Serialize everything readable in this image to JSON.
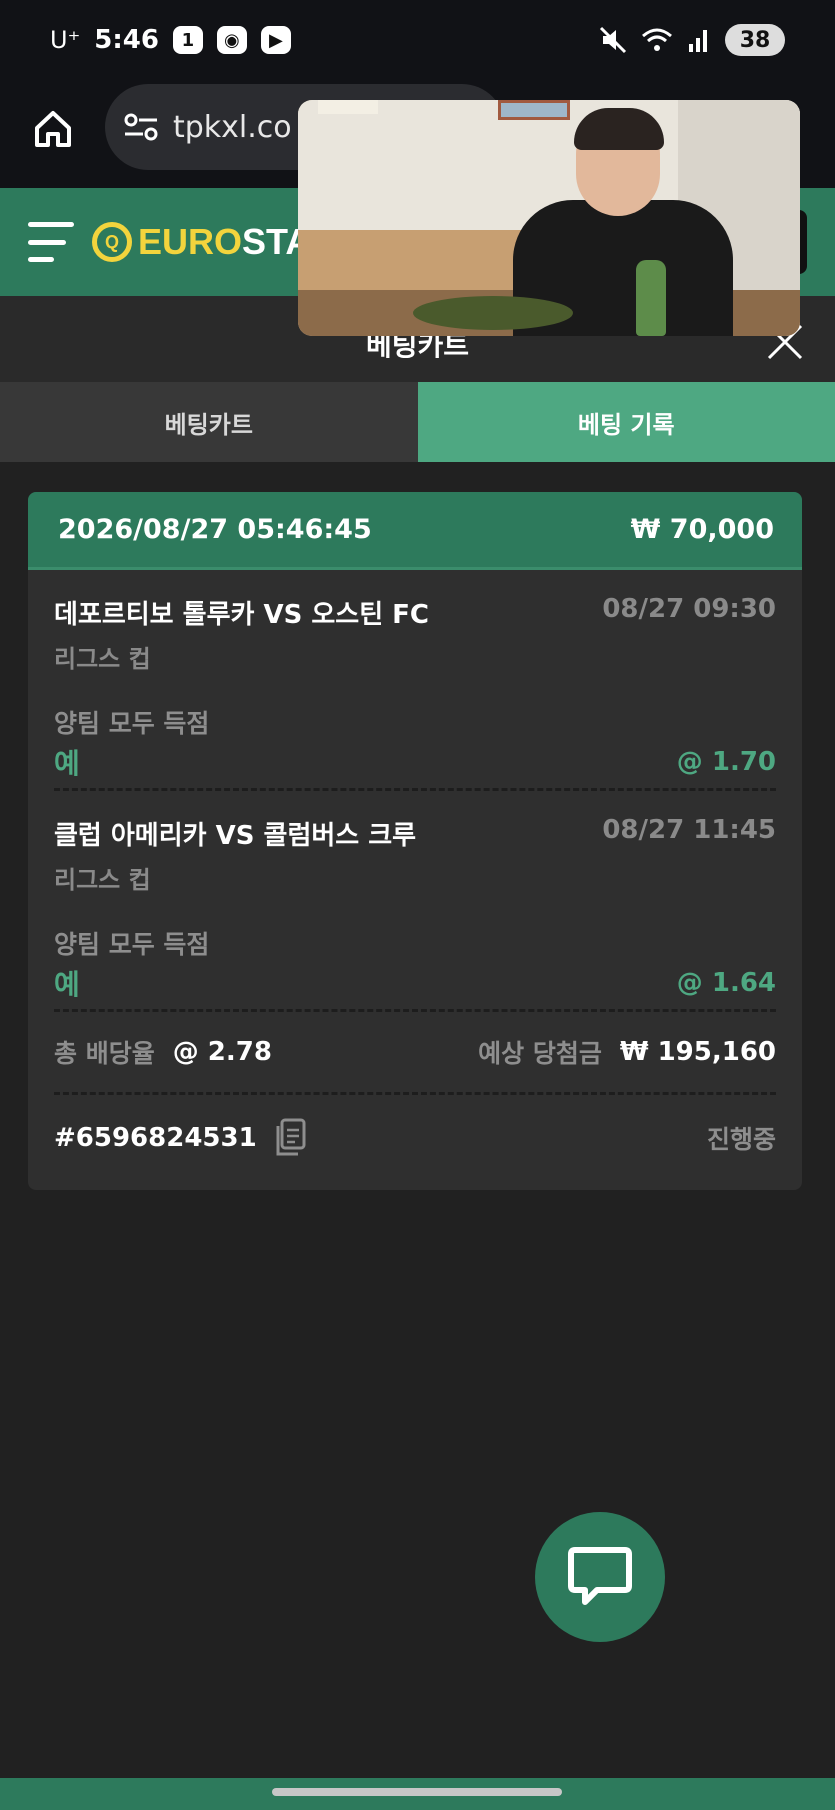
{
  "status_bar": {
    "carrier": "U⁺",
    "time": "5:46",
    "battery": "38"
  },
  "browser": {
    "url": "tpkxl.co"
  },
  "site": {
    "logo_euro": "EURO",
    "logo_sta": "STA"
  },
  "betslip": {
    "title": "베팅카트",
    "tabs": [
      {
        "label": "베팅카트",
        "active": false
      },
      {
        "label": "베팅 기록",
        "active": true
      }
    ]
  },
  "bet_record": {
    "datetime": "2026/08/27 05:46:45",
    "stake": "₩ 70,000",
    "selections": [
      {
        "match": "데포르티보 톨루카 VS 오스틴 FC",
        "time": "08/27 09:30",
        "league": "리그스 컵",
        "market": "양팀 모두 득점",
        "pick": "예",
        "odds": "@ 1.70"
      },
      {
        "match": "클럽 아메리카 VS 콜럼버스 크루",
        "time": "08/27 11:45",
        "league": "리그스 컵",
        "market": "양팀 모두 득점",
        "pick": "예",
        "odds": "@ 1.64"
      }
    ],
    "total_odds_label": "총 배당율",
    "total_odds": "@ 2.78",
    "expected_win_label": "예상 당첨금",
    "expected_win": "₩ 195,160",
    "bet_id": "#6596824531",
    "status": "진행중"
  },
  "colors": {
    "brand_green": "#2d7a5c",
    "tab_active": "#4ea882",
    "logo_yellow": "#f2d43d"
  },
  "icons": [
    "home-icon",
    "site-settings-icon",
    "hamburger-menu-icon",
    "close-icon",
    "copy-icon",
    "chat-icon",
    "mute-icon",
    "wifi-icon",
    "signal-icon"
  ]
}
